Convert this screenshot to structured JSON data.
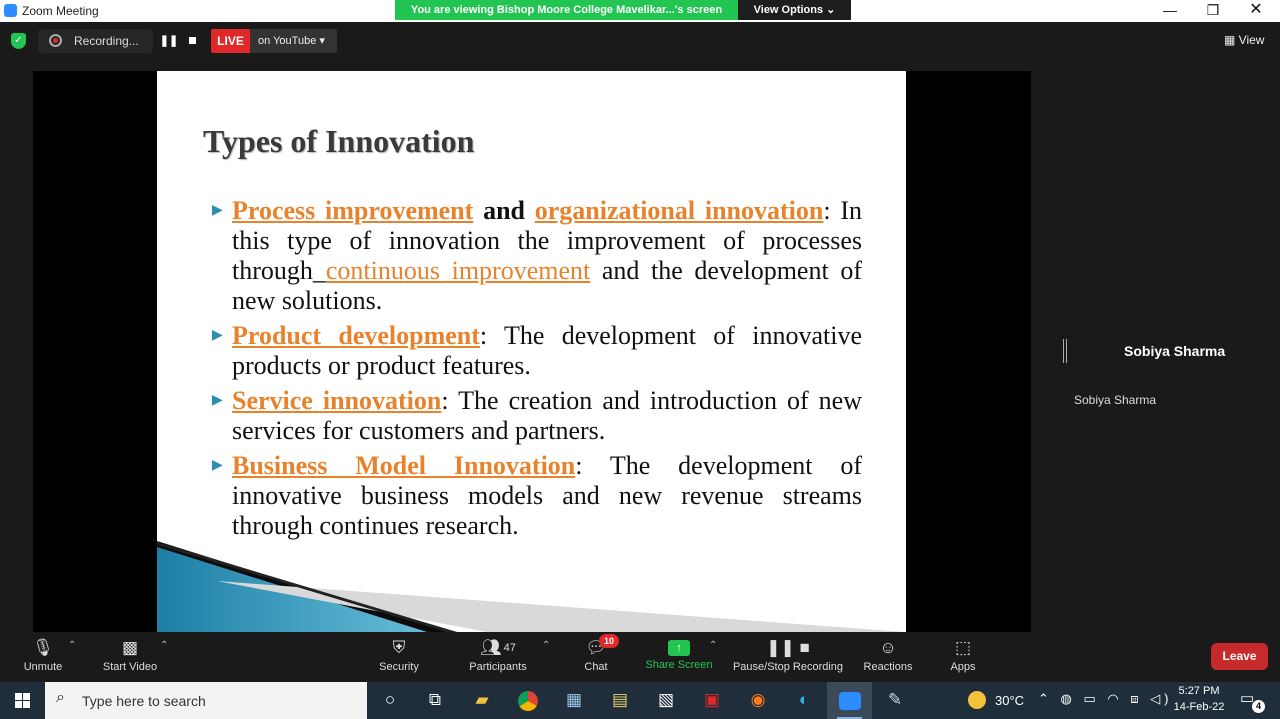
{
  "window": {
    "title": "Zoom Meeting"
  },
  "banner": {
    "text": "You are viewing Bishop Moore College Mavelikar...'s screen",
    "view_options": "View Options ⌄"
  },
  "recording": {
    "label": "Recording...",
    "live": "LIVE",
    "destination": "on YouTube ▾"
  },
  "view_button": "▦ View",
  "slide": {
    "title": "Types of Innovation",
    "bullets": [
      {
        "head": "Process improvement",
        "mid": " and ",
        "head2": "organizational innovation",
        "text_a": ": In this type of innovation the improvement of processes through_",
        "link": "continuous improvement",
        "text_b": " and the development of new solutions."
      },
      {
        "head": "Product development",
        "text": ": The development of innovative products or product features."
      },
      {
        "head": "Service innovation",
        "text": ": The creation and introduction of new services for customers and partners."
      },
      {
        "head": "Business Model Innovation",
        "text": ": The development of innovative business models and new revenue streams through continues research."
      }
    ]
  },
  "participant": {
    "name": "Sobiya Sharma",
    "tag": "Sobiya Sharma"
  },
  "toolbar": {
    "unmute": "Unmute",
    "start_video": "Start Video",
    "security": "Security",
    "participants": "Participants",
    "participants_count": "47",
    "chat": "Chat",
    "chat_badge": "10",
    "share_screen": "Share Screen",
    "pause_stop": "Pause/Stop Recording",
    "reactions": "Reactions",
    "apps": "Apps",
    "leave": "Leave"
  },
  "taskbar": {
    "search_placeholder": "Type here to search",
    "temperature": "30°C",
    "time": "5:27 PM",
    "date": "14-Feb-22",
    "notifications": "4"
  },
  "colors": {
    "accent_green": "#23c552",
    "live_red": "#e02828",
    "slide_highlight": "#e8822b",
    "slide_bullet": "#2a8fb0"
  }
}
